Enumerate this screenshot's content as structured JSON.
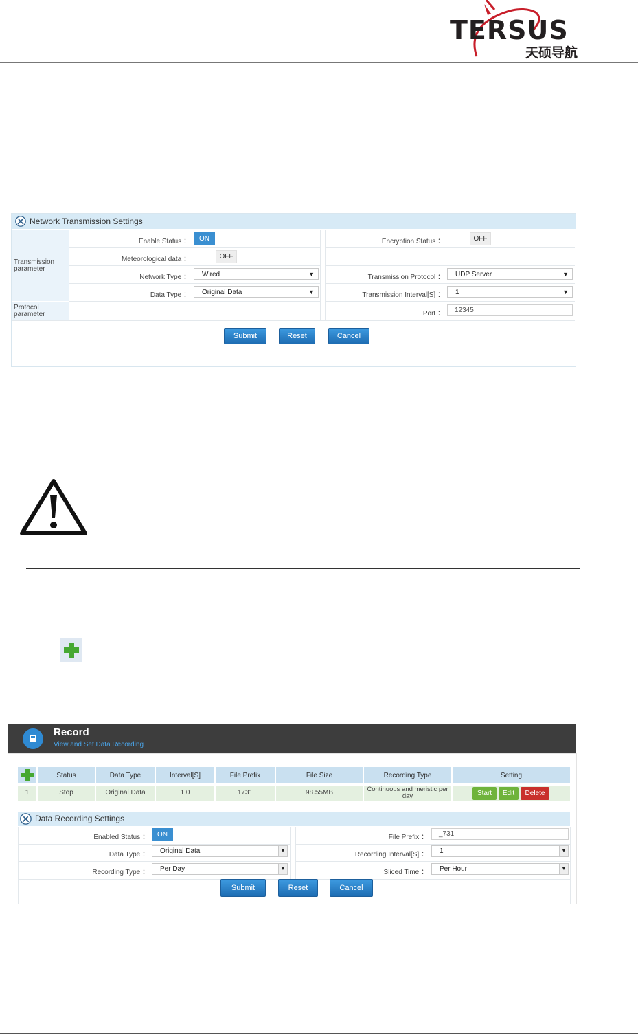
{
  "header": {
    "logo_text": "TERSUS",
    "logo_cn": "天硕导航"
  },
  "network_panel": {
    "title": "Network Transmission Settings",
    "side_labels": {
      "transmission": "Transmission parameter",
      "protocol": "Protocol parameter"
    },
    "enable_status_label": "Enable Status ：",
    "enable_status_value": "ON",
    "meteorological_label": "Meteorological data ：",
    "meteorological_value": "OFF",
    "network_type_label": "Network Type ：",
    "network_type_value": "Wired",
    "data_type_label": "Data Type ：",
    "data_type_value": "Original Data",
    "encryption_label": "Encryption Status ：",
    "encryption_value": "OFF",
    "protocol_label": "Transmission Protocol ：",
    "protocol_value": "UDP Server",
    "interval_label": "Transmission Interval[S] ：",
    "interval_value": "1",
    "port_label": "Port ：",
    "port_value": "12345",
    "buttons": {
      "submit": "Submit",
      "reset": "Reset",
      "cancel": "Cancel"
    }
  },
  "record_panel": {
    "title": "Record",
    "subtitle": "View and Set Data Recording",
    "table": {
      "headers": [
        "Status",
        "Data Type",
        "Interval[S]",
        "File Prefix",
        "File Size",
        "Recording Type",
        "Setting"
      ],
      "row": {
        "index": "1",
        "status": "Stop",
        "data_type": "Original Data",
        "interval": "1.0",
        "file_prefix": "1731",
        "file_size": "98.55MB",
        "recording_type": "Continuous and meristic per day"
      },
      "actions": {
        "start": "Start",
        "edit": "Edit",
        "delete": "Delete"
      }
    },
    "settings": {
      "title": "Data Recording Settings",
      "enabled_status_label": "Enabled Status ：",
      "enabled_status_value": "ON",
      "data_type_label": "Data Type ：",
      "data_type_value": "Original Data",
      "recording_type_label": "Recording Type ：",
      "recording_type_value": "Per Day",
      "file_prefix_label": "File Prefix ：",
      "file_prefix_value": "_731",
      "recording_interval_label": "Recording Interval[S] ：",
      "recording_interval_value": "1",
      "sliced_time_label": "Sliced Time ：",
      "sliced_time_value": "Per Hour",
      "buttons": {
        "submit": "Submit",
        "reset": "Reset",
        "cancel": "Cancel"
      }
    }
  },
  "colors": {
    "accent_blue": "#2f8ad3",
    "green": "#6fb33b",
    "red": "#c9302c",
    "panel_header": "#d7eaf6"
  }
}
